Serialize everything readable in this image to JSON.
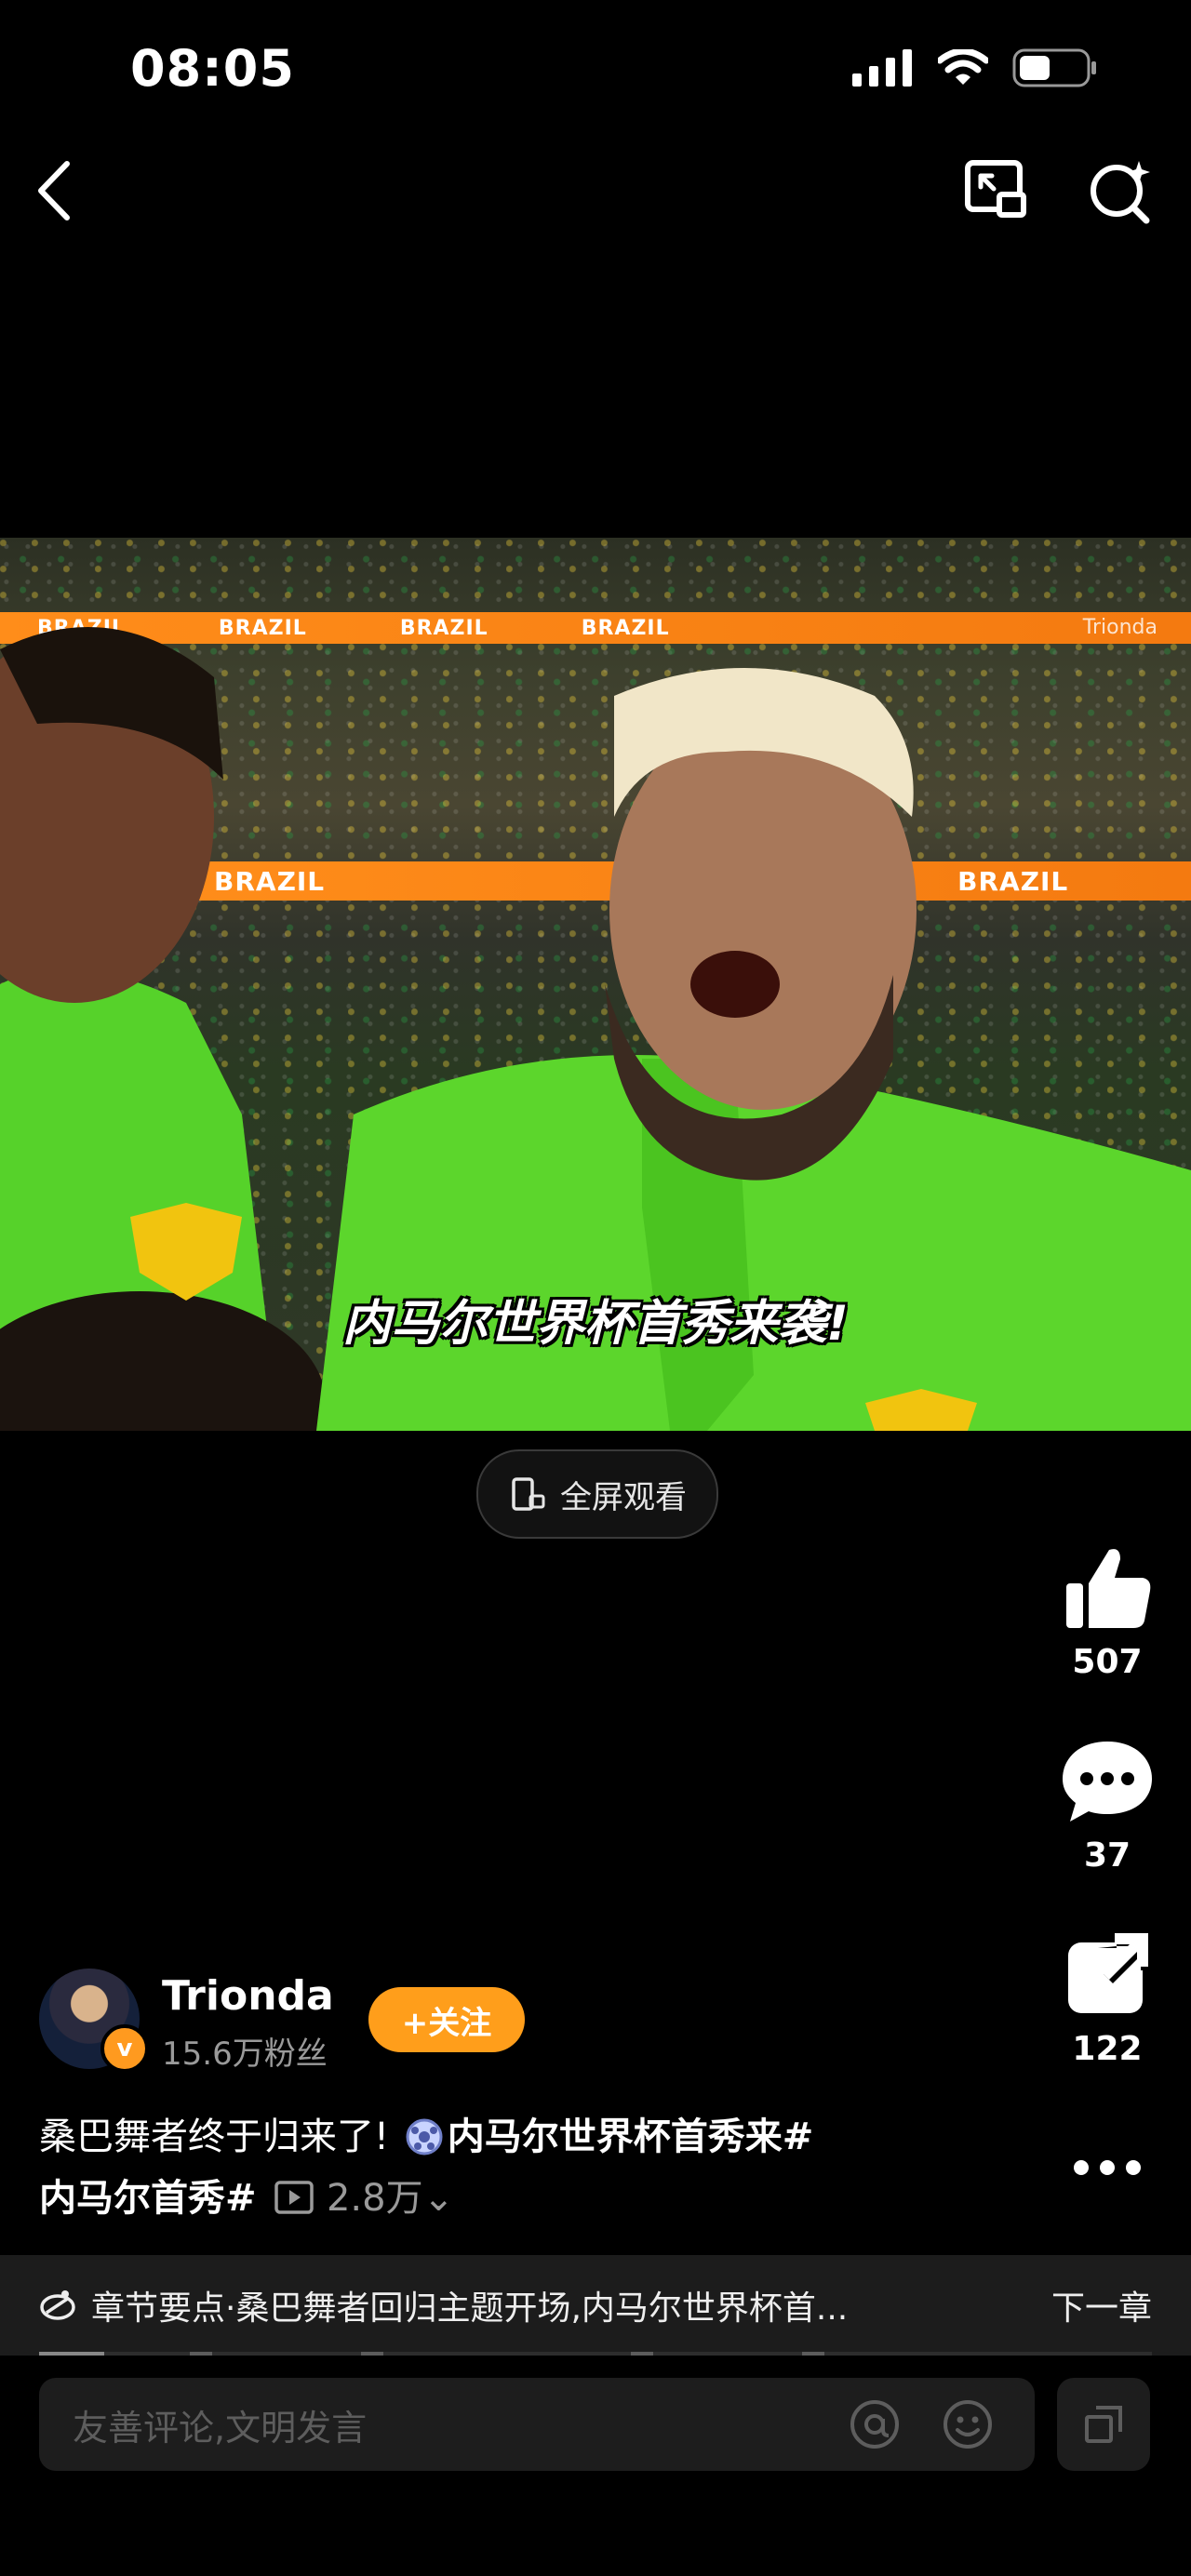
{
  "status_bar": {
    "time": "08:05"
  },
  "video": {
    "watermark": "Trionda",
    "band_text": "BRAZIL",
    "subtitle": "内马尔世界杯首秀来袭!"
  },
  "fullscreen_label": "全屏观看",
  "actions": {
    "like_count": "507",
    "comment_count": "37",
    "share_count": "122"
  },
  "author": {
    "name": "Trionda",
    "fans": "15.6万粉丝",
    "follow_label": "+关注"
  },
  "description": {
    "text": "桑巴舞者终于归来了!",
    "tag1": "内马尔世界杯首秀来#",
    "tag2": "内马尔首秀#",
    "plays": "2.8万"
  },
  "chapter": {
    "summary": "章节要点·桑巴舞者回归主题开场,内马尔世界杯首...",
    "next_label": "下一章"
  },
  "comment": {
    "placeholder": "友善评论,文明发言"
  },
  "colors": {
    "accent": "#ff9e1b",
    "background": "#000000"
  }
}
